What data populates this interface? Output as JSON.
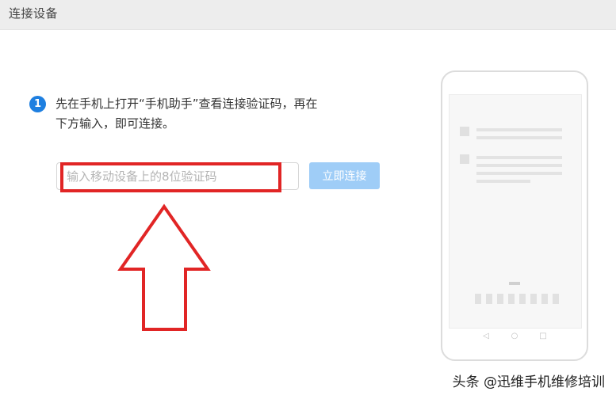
{
  "window": {
    "title": "连接设备"
  },
  "step": {
    "number": "1",
    "line1": "先在手机上打开“手机助手”查看连接验证码，再在",
    "line2": "下方输入，即可连接。"
  },
  "code_input": {
    "placeholder": "输入移动设备上的8位验证码",
    "value": ""
  },
  "connect_button": {
    "label": "立即连接"
  },
  "phone_nav": {
    "back": "◁",
    "home": "○",
    "recent": "□"
  },
  "watermark": "头条 @迅维手机维修培训",
  "colors": {
    "accent": "#1e7fe0",
    "button_disabled": "#9fcdf7",
    "annotation_red": "#e12525",
    "titlebar_bg": "#ededed"
  },
  "icons": {
    "annotation_arrow": "up-arrow-outline",
    "step_badge": "numbered-circle"
  }
}
